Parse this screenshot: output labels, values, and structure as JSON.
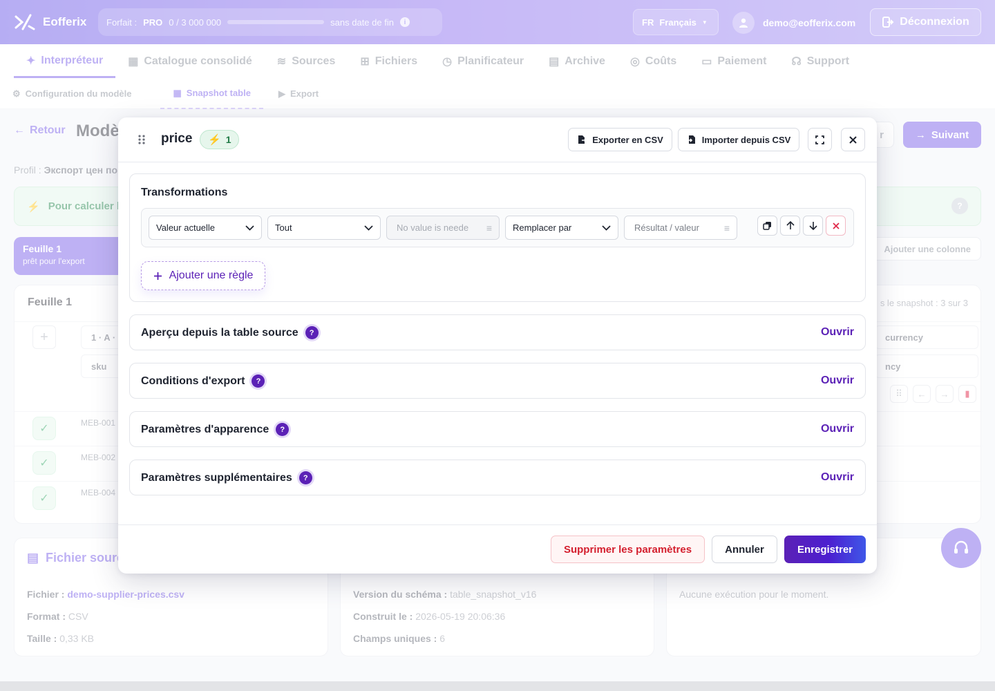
{
  "app": {
    "brand": "Eofferix",
    "plan": {
      "label": "Forfait :",
      "tier": "PRO",
      "usage": "0 / 3 000 000",
      "usage_fraction": 0,
      "expiry": "sans date de fin"
    },
    "language": {
      "code": "FR",
      "name": "Français"
    },
    "user_email": "demo@eofferix.com",
    "logout_label": "Déconnexion",
    "accent_color": "#7c63e8"
  },
  "nav": {
    "items": [
      {
        "label": "Interpréteur",
        "icon": "magic-wand-icon",
        "active": true
      },
      {
        "label": "Catalogue consolidé",
        "icon": "boxes-icon"
      },
      {
        "label": "Sources",
        "icon": "layers-icon"
      },
      {
        "label": "Fichiers",
        "icon": "folder-tree-icon"
      },
      {
        "label": "Planificateur",
        "icon": "clock-icon"
      },
      {
        "label": "Archive",
        "icon": "archive-icon"
      },
      {
        "label": "Coûts",
        "icon": "coins-icon"
      },
      {
        "label": "Paiement",
        "icon": "credit-card-icon"
      },
      {
        "label": "Support",
        "icon": "headset-icon"
      }
    ],
    "sub": [
      {
        "label": "Configuration du modèle",
        "icon": "gear-icon"
      },
      {
        "label": "Snapshot table",
        "icon": "table-icon",
        "active": true
      },
      {
        "label": "Export",
        "icon": "play-circle-icon"
      }
    ]
  },
  "page": {
    "back_label": "Retour",
    "title": "Modè",
    "ghost_button_fragment": "r",
    "next_label": "Suivant",
    "profile_label": "Profil :",
    "profile_value": "Экспорт цен по",
    "tip_text": "Pour calculer le",
    "sheet_tab": {
      "name": "Feuille 1",
      "status": "prêt pour l'export"
    },
    "add_column_label": "Ajouter une colonne",
    "sheet_title": "Feuille 1",
    "snapshot_text": "s le snapshot : 3 sur 3",
    "col_header_1": "1 · A ·",
    "col_field_1": "sku",
    "col_header_right": "currency",
    "col_field_right": "ncy",
    "rows": [
      "MEB-001",
      "MEB-002",
      "MEB-004"
    ],
    "source_card": {
      "title": "Fichier sourc",
      "file_label": "Fichier :",
      "file_value": "demo-supplier-prices.csv",
      "format_label": "Format :",
      "format_value": "CSV",
      "size_label": "Taille :",
      "size_value": "0,33 KB"
    },
    "schema_card": {
      "version_label": "Version du schéma :",
      "version_value": "table_snapshot_v16",
      "built_label": "Construit le :",
      "built_value": "2026-05-19 20:06:36",
      "fields_label": "Champs uniques :",
      "fields_value": "6"
    },
    "runs_card": {
      "empty_text": "Aucune exécution pour le moment."
    }
  },
  "modal": {
    "title": "price",
    "badge_count": "1",
    "export_csv_label": "Exporter en CSV",
    "import_csv_label": "Importer depuis CSV",
    "transformations_title": "Transformations",
    "rule": {
      "source": "Valeur actuelle",
      "scope": "Tout",
      "match_placeholder": "No value is neede",
      "action": "Remplacer par",
      "result_placeholder": "Résultat / valeur"
    },
    "add_rule_label": "Ajouter une règle",
    "sections": [
      {
        "title": "Aperçu depuis la table source",
        "action": "Ouvrir"
      },
      {
        "title": "Conditions d'export",
        "action": "Ouvrir"
      },
      {
        "title": "Paramètres d'apparence",
        "action": "Ouvrir"
      },
      {
        "title": "Paramètres supplémentaires",
        "action": "Ouvrir"
      }
    ],
    "footer": {
      "delete_label": "Supprimer les paramètres",
      "cancel_label": "Annuler",
      "save_label": "Enregistrer"
    }
  }
}
